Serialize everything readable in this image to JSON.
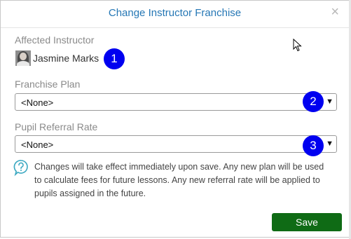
{
  "dialog": {
    "title": "Change Instructor Franchise",
    "close_icon": "×"
  },
  "affected_instructor": {
    "label": "Affected Instructor",
    "name": "Jasmine Marks",
    "badge": "1"
  },
  "franchise_plan": {
    "label": "Franchise Plan",
    "selected": "<None>",
    "badge": "2"
  },
  "pupil_referral_rate": {
    "label": "Pupil Referral Rate",
    "selected": "<None>",
    "badge": "3"
  },
  "info": {
    "icon": "question-icon",
    "text": "Changes will take effect immediately upon save. Any new plan will be used to calculate fees for future lessons. Any new referral rate will be applied to pupils assigned in the future."
  },
  "footer": {
    "save_label": "Save"
  },
  "colors": {
    "title": "#2577b5",
    "save_button": "#0f6b15",
    "badge": "#0000f0",
    "info_icon": "#3aa8c1"
  }
}
